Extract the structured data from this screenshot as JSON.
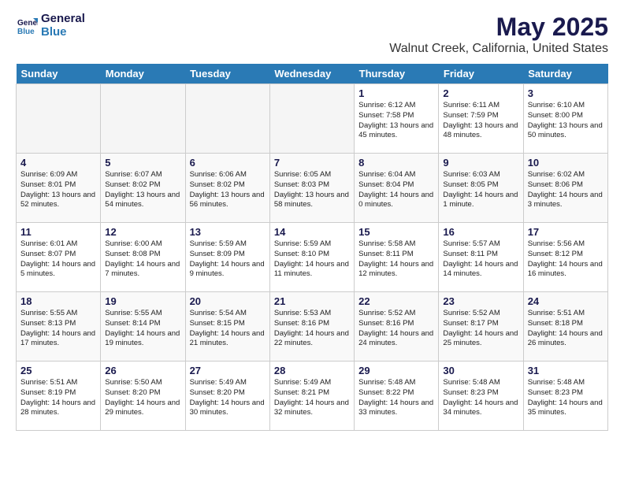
{
  "header": {
    "logo_general": "General",
    "logo_blue": "Blue",
    "month_title": "May 2025",
    "location": "Walnut Creek, California, United States"
  },
  "days_of_week": [
    "Sunday",
    "Monday",
    "Tuesday",
    "Wednesday",
    "Thursday",
    "Friday",
    "Saturday"
  ],
  "weeks": [
    [
      {
        "day": "",
        "content": ""
      },
      {
        "day": "",
        "content": ""
      },
      {
        "day": "",
        "content": ""
      },
      {
        "day": "",
        "content": ""
      },
      {
        "day": "1",
        "content": "Sunrise: 6:12 AM\nSunset: 7:58 PM\nDaylight: 13 hours\nand 45 minutes."
      },
      {
        "day": "2",
        "content": "Sunrise: 6:11 AM\nSunset: 7:59 PM\nDaylight: 13 hours\nand 48 minutes."
      },
      {
        "day": "3",
        "content": "Sunrise: 6:10 AM\nSunset: 8:00 PM\nDaylight: 13 hours\nand 50 minutes."
      }
    ],
    [
      {
        "day": "4",
        "content": "Sunrise: 6:09 AM\nSunset: 8:01 PM\nDaylight: 13 hours\nand 52 minutes."
      },
      {
        "day": "5",
        "content": "Sunrise: 6:07 AM\nSunset: 8:02 PM\nDaylight: 13 hours\nand 54 minutes."
      },
      {
        "day": "6",
        "content": "Sunrise: 6:06 AM\nSunset: 8:02 PM\nDaylight: 13 hours\nand 56 minutes."
      },
      {
        "day": "7",
        "content": "Sunrise: 6:05 AM\nSunset: 8:03 PM\nDaylight: 13 hours\nand 58 minutes."
      },
      {
        "day": "8",
        "content": "Sunrise: 6:04 AM\nSunset: 8:04 PM\nDaylight: 14 hours\nand 0 minutes."
      },
      {
        "day": "9",
        "content": "Sunrise: 6:03 AM\nSunset: 8:05 PM\nDaylight: 14 hours\nand 1 minute."
      },
      {
        "day": "10",
        "content": "Sunrise: 6:02 AM\nSunset: 8:06 PM\nDaylight: 14 hours\nand 3 minutes."
      }
    ],
    [
      {
        "day": "11",
        "content": "Sunrise: 6:01 AM\nSunset: 8:07 PM\nDaylight: 14 hours\nand 5 minutes."
      },
      {
        "day": "12",
        "content": "Sunrise: 6:00 AM\nSunset: 8:08 PM\nDaylight: 14 hours\nand 7 minutes."
      },
      {
        "day": "13",
        "content": "Sunrise: 5:59 AM\nSunset: 8:09 PM\nDaylight: 14 hours\nand 9 minutes."
      },
      {
        "day": "14",
        "content": "Sunrise: 5:59 AM\nSunset: 8:10 PM\nDaylight: 14 hours\nand 11 minutes."
      },
      {
        "day": "15",
        "content": "Sunrise: 5:58 AM\nSunset: 8:11 PM\nDaylight: 14 hours\nand 12 minutes."
      },
      {
        "day": "16",
        "content": "Sunrise: 5:57 AM\nSunset: 8:11 PM\nDaylight: 14 hours\nand 14 minutes."
      },
      {
        "day": "17",
        "content": "Sunrise: 5:56 AM\nSunset: 8:12 PM\nDaylight: 14 hours\nand 16 minutes."
      }
    ],
    [
      {
        "day": "18",
        "content": "Sunrise: 5:55 AM\nSunset: 8:13 PM\nDaylight: 14 hours\nand 17 minutes."
      },
      {
        "day": "19",
        "content": "Sunrise: 5:55 AM\nSunset: 8:14 PM\nDaylight: 14 hours\nand 19 minutes."
      },
      {
        "day": "20",
        "content": "Sunrise: 5:54 AM\nSunset: 8:15 PM\nDaylight: 14 hours\nand 21 minutes."
      },
      {
        "day": "21",
        "content": "Sunrise: 5:53 AM\nSunset: 8:16 PM\nDaylight: 14 hours\nand 22 minutes."
      },
      {
        "day": "22",
        "content": "Sunrise: 5:52 AM\nSunset: 8:16 PM\nDaylight: 14 hours\nand 24 minutes."
      },
      {
        "day": "23",
        "content": "Sunrise: 5:52 AM\nSunset: 8:17 PM\nDaylight: 14 hours\nand 25 minutes."
      },
      {
        "day": "24",
        "content": "Sunrise: 5:51 AM\nSunset: 8:18 PM\nDaylight: 14 hours\nand 26 minutes."
      }
    ],
    [
      {
        "day": "25",
        "content": "Sunrise: 5:51 AM\nSunset: 8:19 PM\nDaylight: 14 hours\nand 28 minutes."
      },
      {
        "day": "26",
        "content": "Sunrise: 5:50 AM\nSunset: 8:20 PM\nDaylight: 14 hours\nand 29 minutes."
      },
      {
        "day": "27",
        "content": "Sunrise: 5:49 AM\nSunset: 8:20 PM\nDaylight: 14 hours\nand 30 minutes."
      },
      {
        "day": "28",
        "content": "Sunrise: 5:49 AM\nSunset: 8:21 PM\nDaylight: 14 hours\nand 32 minutes."
      },
      {
        "day": "29",
        "content": "Sunrise: 5:48 AM\nSunset: 8:22 PM\nDaylight: 14 hours\nand 33 minutes."
      },
      {
        "day": "30",
        "content": "Sunrise: 5:48 AM\nSunset: 8:23 PM\nDaylight: 14 hours\nand 34 minutes."
      },
      {
        "day": "31",
        "content": "Sunrise: 5:48 AM\nSunset: 8:23 PM\nDaylight: 14 hours\nand 35 minutes."
      }
    ]
  ]
}
